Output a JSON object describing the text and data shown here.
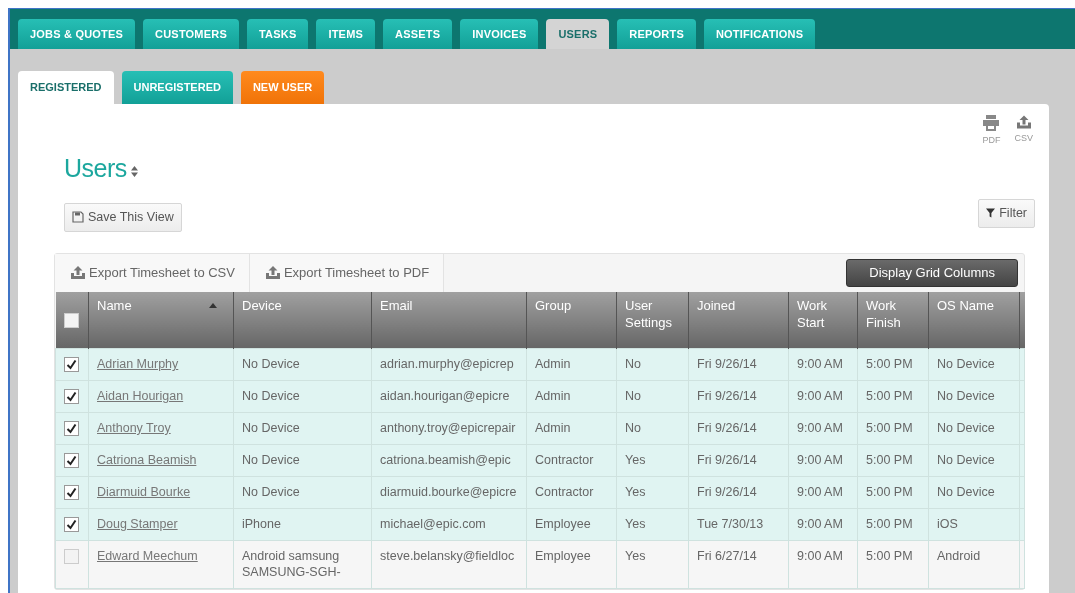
{
  "main_tabs": [
    {
      "label": "JOBS & QUOTES",
      "selected": false
    },
    {
      "label": "CUSTOMERS",
      "selected": false
    },
    {
      "label": "TASKS",
      "selected": false
    },
    {
      "label": "ITEMS",
      "selected": false
    },
    {
      "label": "ASSETS",
      "selected": false
    },
    {
      "label": "INVOICES",
      "selected": false
    },
    {
      "label": "USERS",
      "selected": true
    },
    {
      "label": "REPORTS",
      "selected": false
    },
    {
      "label": "NOTIFICATIONS",
      "selected": false
    }
  ],
  "sub_tabs": [
    {
      "label": "REGISTERED",
      "selected": true,
      "kind": "tab"
    },
    {
      "label": "UNREGISTERED",
      "selected": false,
      "kind": "tab"
    },
    {
      "label": "NEW USER",
      "selected": false,
      "kind": "action"
    }
  ],
  "export_icons": [
    {
      "label": "PDF",
      "kind": "print"
    },
    {
      "label": "CSV",
      "kind": "upload"
    }
  ],
  "title": "Users",
  "save_view_button": "Save This View",
  "filter_button": "Filter",
  "toolbar": {
    "buttons": [
      "Export Timesheet to CSV",
      "Export Timesheet to PDF"
    ],
    "columns_button": "Display Grid Columns"
  },
  "table": {
    "select_all_checked": false,
    "columns": [
      {
        "label": "Name",
        "sorted": true
      },
      {
        "label": "Device",
        "sorted": false
      },
      {
        "label": "Email",
        "sorted": false
      },
      {
        "label": "Group",
        "sorted": false
      },
      {
        "label": "User Settings",
        "sorted": false
      },
      {
        "label": "Joined",
        "sorted": false
      },
      {
        "label": "Work Start",
        "sorted": false
      },
      {
        "label": "Work Finish",
        "sorted": false
      },
      {
        "label": "OS Name",
        "sorted": false
      }
    ],
    "rows": [
      {
        "checked": true,
        "cells": [
          "Adrian Murphy",
          "No Device",
          "adrian.murphy@epicrep",
          "Admin",
          "No",
          "Fri 9/26/14",
          "9:00 AM",
          "5:00 PM",
          "No Device"
        ]
      },
      {
        "checked": true,
        "cells": [
          "Aidan Hourigan",
          "No Device",
          "aidan.hourigan@epicre",
          "Admin",
          "No",
          "Fri 9/26/14",
          "9:00 AM",
          "5:00 PM",
          "No Device"
        ]
      },
      {
        "checked": true,
        "cells": [
          "Anthony Troy",
          "No Device",
          "anthony.troy@epicrepair",
          "Admin",
          "No",
          "Fri 9/26/14",
          "9:00 AM",
          "5:00 PM",
          "No Device"
        ]
      },
      {
        "checked": true,
        "cells": [
          "Catriona Beamish",
          "No Device",
          "catriona.beamish@epic",
          "Contractor",
          "Yes",
          "Fri 9/26/14",
          "9:00 AM",
          "5:00 PM",
          "No Device"
        ]
      },
      {
        "checked": true,
        "cells": [
          "Diarmuid Bourke",
          "No Device",
          "diarmuid.bourke@epicre",
          "Contractor",
          "Yes",
          "Fri 9/26/14",
          "9:00 AM",
          "5:00 PM",
          "No Device"
        ]
      },
      {
        "checked": true,
        "cells": [
          "Doug Stamper",
          "iPhone",
          "michael@epic.com",
          "Employee",
          "Yes",
          "Tue 7/30/13",
          "9:00 AM",
          "5:00 PM",
          "iOS"
        ]
      },
      {
        "checked": false,
        "cells": [
          "Edward Meechum",
          "Android samsung SAMSUNG-SGH-",
          "steve.belansky@fieldloc",
          "Employee",
          "Yes",
          "Fri 6/27/14",
          "9:00 AM",
          "5:00 PM",
          "Android"
        ]
      }
    ]
  }
}
